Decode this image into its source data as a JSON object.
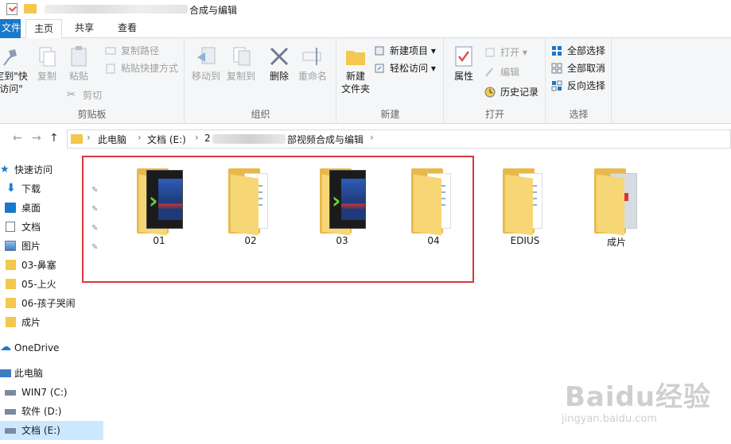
{
  "window": {
    "title": "合成与编辑"
  },
  "tabs": {
    "file": "文件",
    "home": "主页",
    "share": "共享",
    "view": "查看"
  },
  "ribbon": {
    "clipboard": {
      "pin": "固定到\"快速访问\"",
      "pin_line1": "定到\"快",
      "pin_line2": "访问\"",
      "copy": "复制",
      "paste": "粘贴",
      "copy_path": "复制路径",
      "paste_shortcut": "粘贴快捷方式",
      "cut": "剪切",
      "label": "剪贴板"
    },
    "organize": {
      "move_to": "移动到",
      "copy_to": "复制到",
      "delete": "删除",
      "rename": "重命名",
      "label": "组织"
    },
    "new": {
      "new_folder_line1": "新建",
      "new_folder_line2": "文件夹",
      "new_item": "新建项目",
      "easy_access": "轻松访问",
      "label": "新建"
    },
    "open": {
      "properties": "属性",
      "open": "打开",
      "edit": "编辑",
      "history": "历史记录",
      "label": "打开"
    },
    "select": {
      "select_all": "全部选择",
      "select_none": "全部取消",
      "invert": "反向选择",
      "label": "选择"
    }
  },
  "address": {
    "crumbs": [
      "此电脑",
      "文档 (E:)",
      "2",
      "部视频合成与编辑"
    ]
  },
  "nav": {
    "quick_access": "快速访问",
    "items": [
      "下载",
      "桌面",
      "文档",
      "图片",
      "03-鼻塞",
      "05-上火",
      "06-孩子哭闹",
      "成片"
    ],
    "onedrive": "OneDrive",
    "this_pc": "此电脑",
    "drives": [
      "WIN7 (C:)",
      "软件 (D:)",
      "文档 (E:)"
    ]
  },
  "files": [
    {
      "name": "01",
      "kind": "video"
    },
    {
      "name": "02",
      "kind": "docs"
    },
    {
      "name": "03",
      "kind": "video"
    },
    {
      "name": "04",
      "kind": "docs"
    },
    {
      "name": "EDIUS",
      "kind": "docs"
    },
    {
      "name": "成片",
      "kind": "red"
    }
  ],
  "watermark": {
    "brand": "Baidu经验",
    "url": "jingyan.baidu.com"
  },
  "colors": {
    "accent": "#1979ca",
    "highlight": "#d9373b",
    "folder": "#f7d675",
    "selection": "#cce8ff"
  }
}
